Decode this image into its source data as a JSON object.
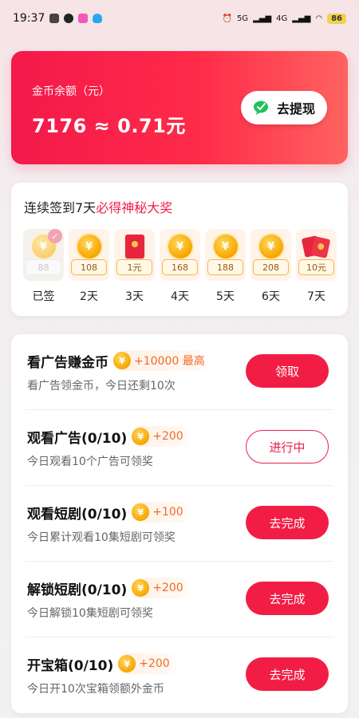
{
  "status_bar": {
    "time": "19:37",
    "network_5g": "5G",
    "network_4g": "4G",
    "battery": "86"
  },
  "balance": {
    "label": "金币余额（元）",
    "value": "7176 ≈ 0.71元",
    "withdraw_label": "去提现"
  },
  "signin": {
    "title_prefix": "连续签到7天",
    "title_highlight": "必得神秘大奖",
    "days": [
      {
        "label": "已签",
        "amount": "88",
        "icon": "coin-icon",
        "done": true
      },
      {
        "label": "2天",
        "amount": "108",
        "icon": "coin-icon",
        "done": false
      },
      {
        "label": "3天",
        "amount": "1元",
        "icon": "red-envelope-icon",
        "done": false
      },
      {
        "label": "4天",
        "amount": "168",
        "icon": "coin-icon",
        "done": false
      },
      {
        "label": "5天",
        "amount": "188",
        "icon": "coin-icon",
        "done": false
      },
      {
        "label": "6天",
        "amount": "208",
        "icon": "coin-icon",
        "done": false
      },
      {
        "label": "7天",
        "amount": "10元",
        "icon": "red-envelope-stack-icon",
        "done": false
      }
    ]
  },
  "tasks": [
    {
      "title": "看广告赚金币",
      "reward": "+10000 最高",
      "desc": "看广告领金币，今日还剩10次",
      "button": "领取",
      "style": "filled"
    },
    {
      "title": "观看广告(0/10)",
      "reward": "+200",
      "desc": "今日观看10个广告可领奖",
      "button": "进行中",
      "style": "outline"
    },
    {
      "title": "观看短剧(0/10)",
      "reward": "+100",
      "desc": "今日累计观看10集短剧可领奖",
      "button": "去完成",
      "style": "filled"
    },
    {
      "title": "解锁短剧(0/10)",
      "reward": "+200",
      "desc": "今日解锁10集短剧可领奖",
      "button": "去完成",
      "style": "filled"
    },
    {
      "title": "开宝箱(0/10)",
      "reward": "+200",
      "desc": "今日开10次宝箱领额外金币",
      "button": "去完成",
      "style": "filled"
    }
  ],
  "colors": {
    "brand_red": "#f21d45",
    "reward_orange": "#f06a2a",
    "coin_gold": "#f7a600"
  }
}
